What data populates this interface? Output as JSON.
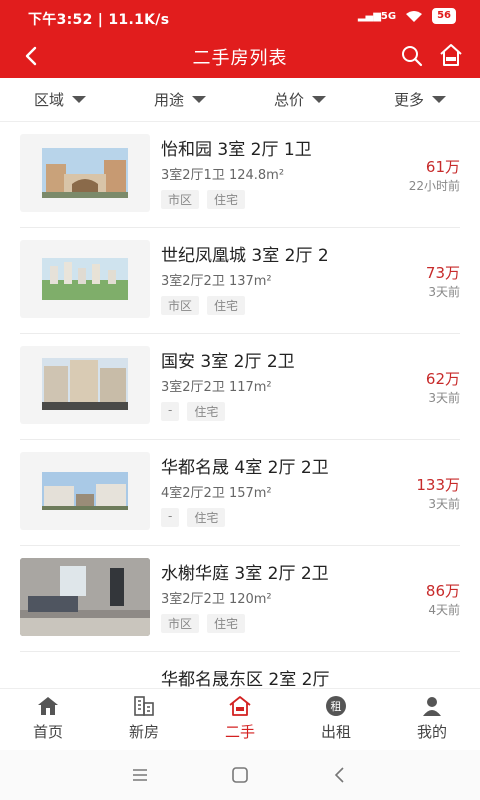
{
  "status": {
    "time": "下午3:52",
    "speed": "11.1K/s",
    "signal": "5G",
    "battery": "56"
  },
  "header": {
    "title": "二手房列表"
  },
  "filters": [
    {
      "label": "区域"
    },
    {
      "label": "用途"
    },
    {
      "label": "总价"
    },
    {
      "label": "更多"
    }
  ],
  "listings": [
    {
      "name": "怡和园 3室 2厅 1卫",
      "spec": "3室2厅1卫 124.8m²",
      "tags": [
        "市区",
        "住宅"
      ],
      "price": "61万",
      "time": "22小时前"
    },
    {
      "name": "世纪凤凰城 3室 2厅 2",
      "spec": "3室2厅2卫 137m²",
      "tags": [
        "市区",
        "住宅"
      ],
      "price": "73万",
      "time": "3天前"
    },
    {
      "name": "国安 3室 2厅 2卫",
      "spec": "3室2厅2卫 117m²",
      "tags": [
        "-",
        "住宅"
      ],
      "price": "62万",
      "time": "3天前"
    },
    {
      "name": "华都名晟 4室 2厅 2卫",
      "spec": "4室2厅2卫 157m²",
      "tags": [
        "-",
        "住宅"
      ],
      "price": "133万",
      "time": "3天前"
    },
    {
      "name": "水榭华庭 3室 2厅 2卫",
      "spec": "3室2厅2卫 120m²",
      "tags": [
        "市区",
        "住宅"
      ],
      "price": "86万",
      "time": "4天前"
    },
    {
      "name": "华都名晟东区 2室 2厅",
      "spec": "",
      "tags": [],
      "price": "",
      "time": ""
    }
  ],
  "tabbar": [
    {
      "label": "首页",
      "icon": "home-icon"
    },
    {
      "label": "新房",
      "icon": "building-icon"
    },
    {
      "label": "二手",
      "icon": "sale-house-icon",
      "active": true
    },
    {
      "label": "出租",
      "icon": "rent-icon"
    },
    {
      "label": "我的",
      "icon": "user-icon"
    }
  ],
  "colors": {
    "brand": "#e11d1d",
    "price": "#c72a2a"
  }
}
